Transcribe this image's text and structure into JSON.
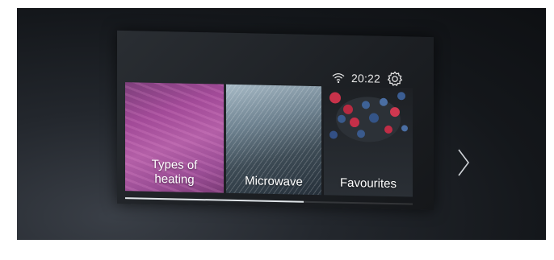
{
  "status": {
    "time": "20:22",
    "icons": [
      "wifi-icon",
      "gear-icon"
    ]
  },
  "tiles": [
    {
      "label_lines": [
        "Types of",
        "heating"
      ],
      "image": "pink-heat-waves"
    },
    {
      "label_lines": [
        "Microwave"
      ],
      "image": "silver-wave-mesh"
    },
    {
      "label_lines": [
        "Favourites"
      ],
      "image": "berries-dessert"
    }
  ],
  "navigation": {
    "next_icon": "chevron-right-icon"
  },
  "scroll": {
    "position_fraction": 0.62
  },
  "colors": {
    "background": "#14171b",
    "text": "#ffffff",
    "accent_heating": "#a24a98"
  }
}
